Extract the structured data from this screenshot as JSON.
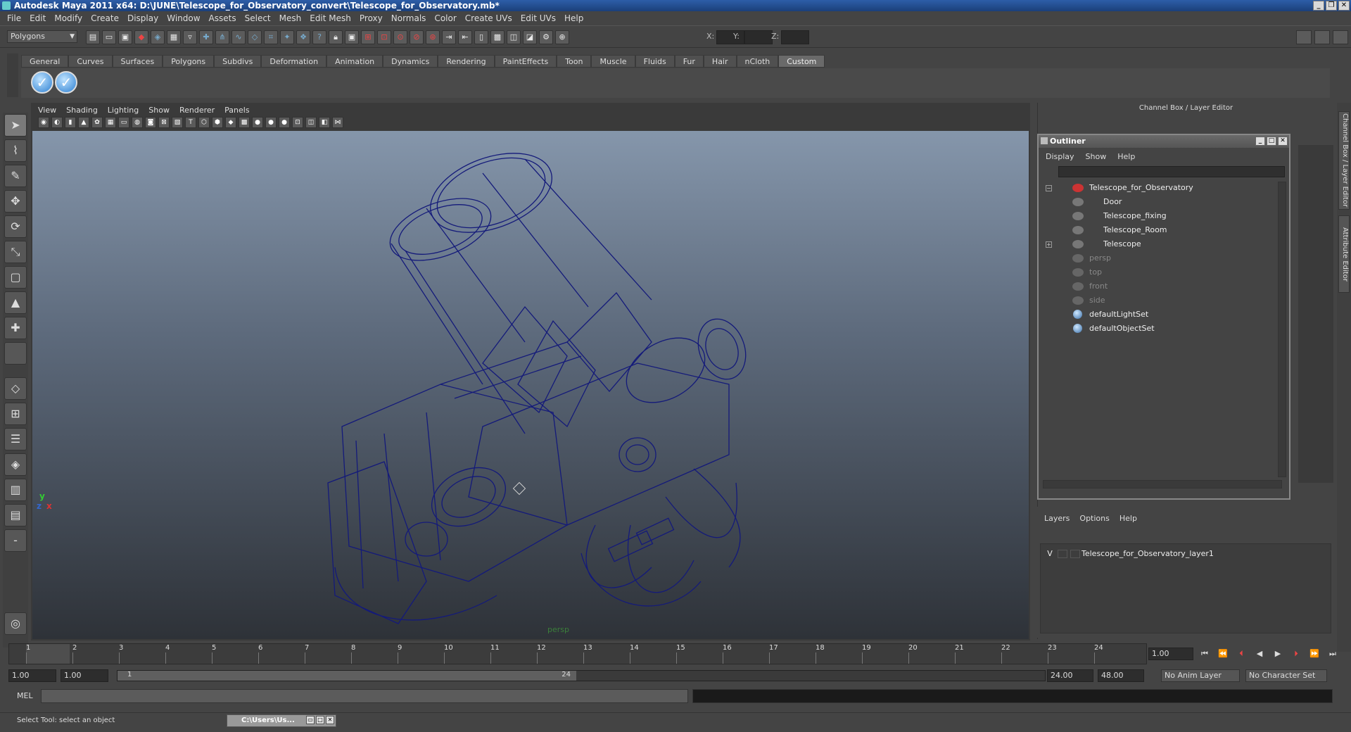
{
  "window": {
    "title": "Autodesk Maya 2011 x64: D:\\JUNE\\Telescope_for_Observatory_convert\\Telescope_for_Observatory.mb*",
    "min": "_",
    "max": "❐",
    "close": "✕"
  },
  "menubar": [
    "File",
    "Edit",
    "Modify",
    "Create",
    "Display",
    "Window",
    "Assets",
    "Select",
    "Mesh",
    "Edit Mesh",
    "Proxy",
    "Normals",
    "Color",
    "Create UVs",
    "Edit UVs",
    "Help"
  ],
  "status": {
    "mode": "Polygons",
    "x_label": "X:",
    "y_label": "Y:",
    "z_label": "Z:"
  },
  "shelf": {
    "tabs": [
      "General",
      "Curves",
      "Surfaces",
      "Polygons",
      "Subdivs",
      "Deformation",
      "Animation",
      "Dynamics",
      "Rendering",
      "PaintEffects",
      "Toon",
      "Muscle",
      "Fluids",
      "Fur",
      "Hair",
      "nCloth",
      "Custom"
    ],
    "active_tab": "Custom"
  },
  "viewport": {
    "menu": [
      "View",
      "Shading",
      "Lighting",
      "Show",
      "Renderer",
      "Panels"
    ],
    "camera_label": "persp",
    "axis_y": "y",
    "axis_x": "x",
    "axis_z": "z"
  },
  "channel_box": {
    "header": "Channel Box / Layer Editor"
  },
  "side_tabs": {
    "channel_box": "Channel Box / Layer Editor",
    "attribute_editor": "Attribute Editor"
  },
  "outliner": {
    "title": "Outliner",
    "menu": [
      "Display",
      "Show",
      "Help"
    ],
    "items": [
      {
        "label": "Telescope_for_Observatory",
        "dim": false
      },
      {
        "label": "Door",
        "dim": false
      },
      {
        "label": "Telescope_fixing",
        "dim": false
      },
      {
        "label": "Telescope_Room",
        "dim": false
      },
      {
        "label": "Telescope",
        "dim": false
      },
      {
        "label": "persp",
        "dim": true
      },
      {
        "label": "top",
        "dim": true
      },
      {
        "label": "front",
        "dim": true
      },
      {
        "label": "side",
        "dim": true
      },
      {
        "label": "defaultLightSet",
        "dim": false
      },
      {
        "label": "defaultObjectSet",
        "dim": false
      }
    ]
  },
  "layer_editor": {
    "menu": [
      "Layers",
      "Options",
      "Help"
    ],
    "layers": [
      {
        "visible": "V",
        "name": "Telescope_for_Observatory_layer1"
      }
    ]
  },
  "timeline": {
    "ticks": [
      "1",
      "2",
      "3",
      "4",
      "5",
      "6",
      "7",
      "8",
      "9",
      "10",
      "11",
      "12",
      "13",
      "14",
      "15",
      "16",
      "17",
      "18",
      "19",
      "20",
      "21",
      "22",
      "23",
      "24"
    ],
    "current_frame": "1.00"
  },
  "range": {
    "start": "1.00",
    "playback_start": "1.00",
    "handle_start": "1",
    "handle_end": "24",
    "playback_end": "24.00",
    "end": "48.00",
    "anim_layer": "No Anim Layer",
    "character_set": "No Character Set"
  },
  "cmdline": {
    "label": "MEL"
  },
  "helpline": {
    "text": "Select Tool: select an object",
    "task_label": "C:\\Users\\Us..."
  }
}
